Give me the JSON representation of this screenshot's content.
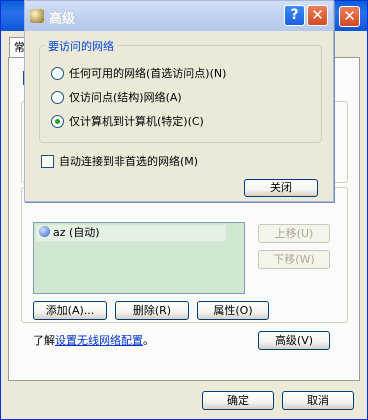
{
  "back_window": {
    "tab_label": "常",
    "networks_list": [
      {
        "name": "az",
        "status": "(自动)"
      }
    ],
    "buttons": {
      "move_up": "上移(U)",
      "move_down": "下移(W)",
      "add": "添加(A)...",
      "remove": "删除(R)",
      "properties": "属性(O)",
      "advanced": "高级(V)",
      "ok": "确定",
      "cancel": "取消"
    },
    "info": {
      "prefix": "了解",
      "link": "设置无线网络配置",
      "suffix": "。"
    }
  },
  "dialog": {
    "title": "高级",
    "group_label": "要访问的网络",
    "options": [
      {
        "label": "任何可用的网络(首选访问点)(N)",
        "selected": false
      },
      {
        "label": "仅访问点(结构)网络(A)",
        "selected": false
      },
      {
        "label": "仅计算机到计算机(特定)(C)",
        "selected": true
      }
    ],
    "auto_connect_label": "自动连接到非首选的网络(M)",
    "auto_connect_checked": false,
    "close_button": "关闭"
  }
}
